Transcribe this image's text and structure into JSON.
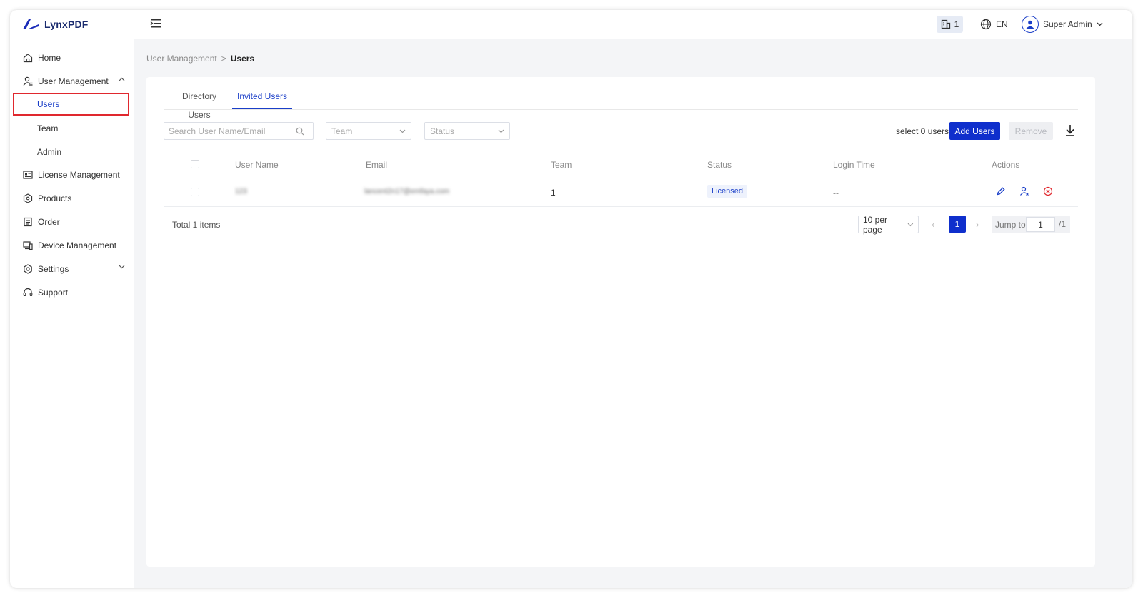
{
  "app": {
    "brand": "LynxPDF",
    "accent": "#0f2fcc"
  },
  "header": {
    "org_count": "1",
    "language": "EN",
    "user_name": "Super Admin"
  },
  "sidebar": {
    "items": [
      {
        "label": "Home",
        "icon": "home-icon"
      },
      {
        "label": "User Management",
        "icon": "user-manage-icon",
        "expanded": true
      },
      {
        "label": "Users",
        "sub": true,
        "active": true
      },
      {
        "label": "Team",
        "sub": true
      },
      {
        "label": "Admin",
        "sub": true
      },
      {
        "label": "License Management",
        "icon": "license-icon"
      },
      {
        "label": "Products",
        "icon": "products-icon"
      },
      {
        "label": "Order",
        "icon": "order-icon"
      },
      {
        "label": "Device Management",
        "icon": "device-icon"
      },
      {
        "label": "Settings",
        "icon": "settings-icon",
        "expanded": false
      },
      {
        "label": "Support",
        "icon": "support-icon"
      }
    ]
  },
  "breadcrumb": {
    "parent": "User Management",
    "separator": ">",
    "current": "Users"
  },
  "tabs": [
    {
      "label": "Directory Users",
      "active": false
    },
    {
      "label": "Invited Users",
      "active": true
    }
  ],
  "filters": {
    "search_placeholder": "Search User Name/Email",
    "team_placeholder": "Team",
    "status_placeholder": "Status"
  },
  "toolbar": {
    "selected_text": "select 0 users",
    "add_label": "Add Users",
    "remove_label": "Remove"
  },
  "table": {
    "columns": [
      "User Name",
      "Email",
      "Team",
      "Status",
      "Login Time",
      "Actions"
    ],
    "rows": [
      {
        "user_name": "123",
        "email": "lancent2n17@emfaya.com",
        "team": "1",
        "status": "Licensed",
        "login_time": "--"
      }
    ]
  },
  "pagination": {
    "total_text": "Total 1 items",
    "page_size": "10 per page",
    "current_page": "1",
    "jump_label": "Jump to",
    "jump_value": "1",
    "total_pages": "/1"
  }
}
